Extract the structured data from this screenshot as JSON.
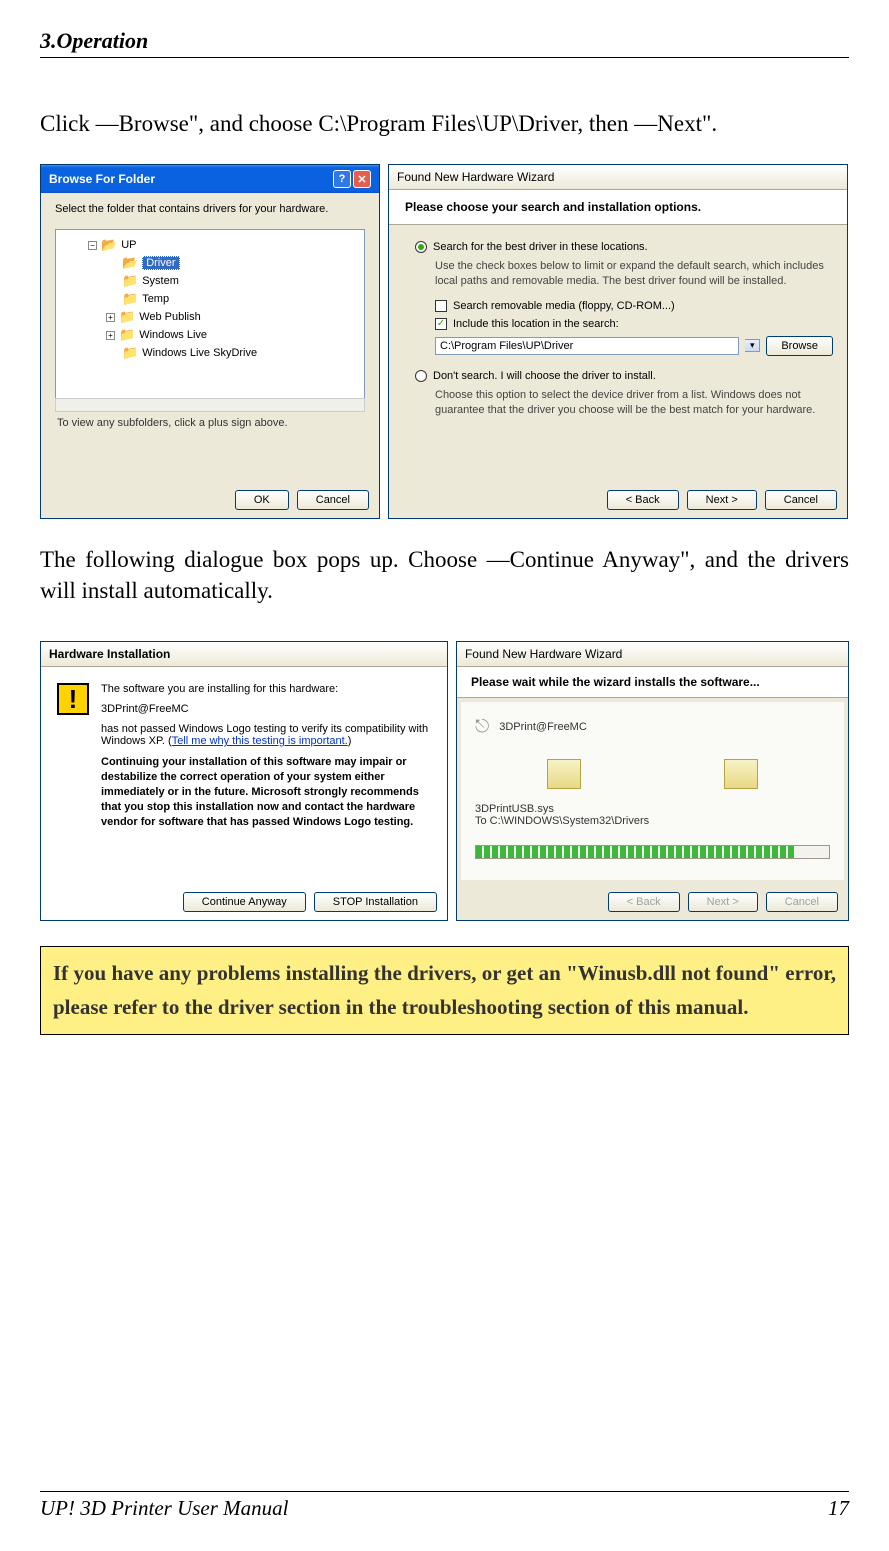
{
  "header": {
    "section": "3.Operation"
  },
  "para1": "Click ―Browse\", and choose C:\\Program Files\\UP\\Driver, then ―Next\".",
  "para2": "The following dialogue box pops up. Choose ―Continue Anyway\", and the drivers will install automatically.",
  "browseDialog": {
    "title": "Browse For Folder",
    "instruction": "Select the folder that contains drivers for your hardware.",
    "tree": {
      "root": "UP",
      "items": [
        "Driver",
        "System",
        "Temp",
        "Web Publish",
        "Windows Live",
        "Windows Live SkyDrive"
      ]
    },
    "footnote": "To view any subfolders, click a plus sign above.",
    "ok": "OK",
    "cancel": "Cancel"
  },
  "wizardDialog": {
    "title": "Found New Hardware Wizard",
    "heading": "Please choose your search and installation options.",
    "opt1": "Search for the best driver in these locations.",
    "opt1desc": "Use the check boxes below to limit or expand the default search, which includes local paths and removable media. The best driver found will be installed.",
    "cb1": "Search removable media (floppy, CD-ROM...)",
    "cb2": "Include this location in the search:",
    "path": "C:\\Program Files\\UP\\Driver",
    "browse": "Browse",
    "opt2": "Don't search. I will choose the driver to install.",
    "opt2desc": "Choose this option to select the device driver from a list. Windows does not guarantee that the driver you choose will be the best match for your hardware.",
    "back": "< Back",
    "next": "Next >",
    "cancel": "Cancel"
  },
  "hwDialog": {
    "title": "Hardware Installation",
    "line1": "The software you are installing for this hardware:",
    "device": "3DPrint@FreeMC",
    "line2a": "has not passed Windows Logo testing to verify its compatibility with Windows XP. (",
    "link": "Tell me why this testing is important.",
    "line2b": ")",
    "bold": "Continuing your installation of this software may impair or destabilize the correct operation of your system either immediately or in the future. Microsoft strongly recommends that you stop this installation now and contact the hardware vendor for software that has passed Windows Logo testing.",
    "continue": "Continue Anyway",
    "stop": "STOP Installation"
  },
  "progDialog": {
    "title": "Found New Hardware Wizard",
    "heading": "Please wait while the wizard installs the software...",
    "device": "3DPrint@FreeMC",
    "file": "3DPrintUSB.sys",
    "dest": "To C:\\WINDOWS\\System32\\Drivers",
    "back": "< Back",
    "next": "Next >",
    "cancel": "Cancel"
  },
  "warningBox": "If you have any problems installing the drivers, or get an \"Winusb.dll not found\" error, please refer to the driver section in the troubleshooting section of this manual.",
  "footer": {
    "left": "UP! 3D Printer User Manual",
    "right": "17"
  }
}
